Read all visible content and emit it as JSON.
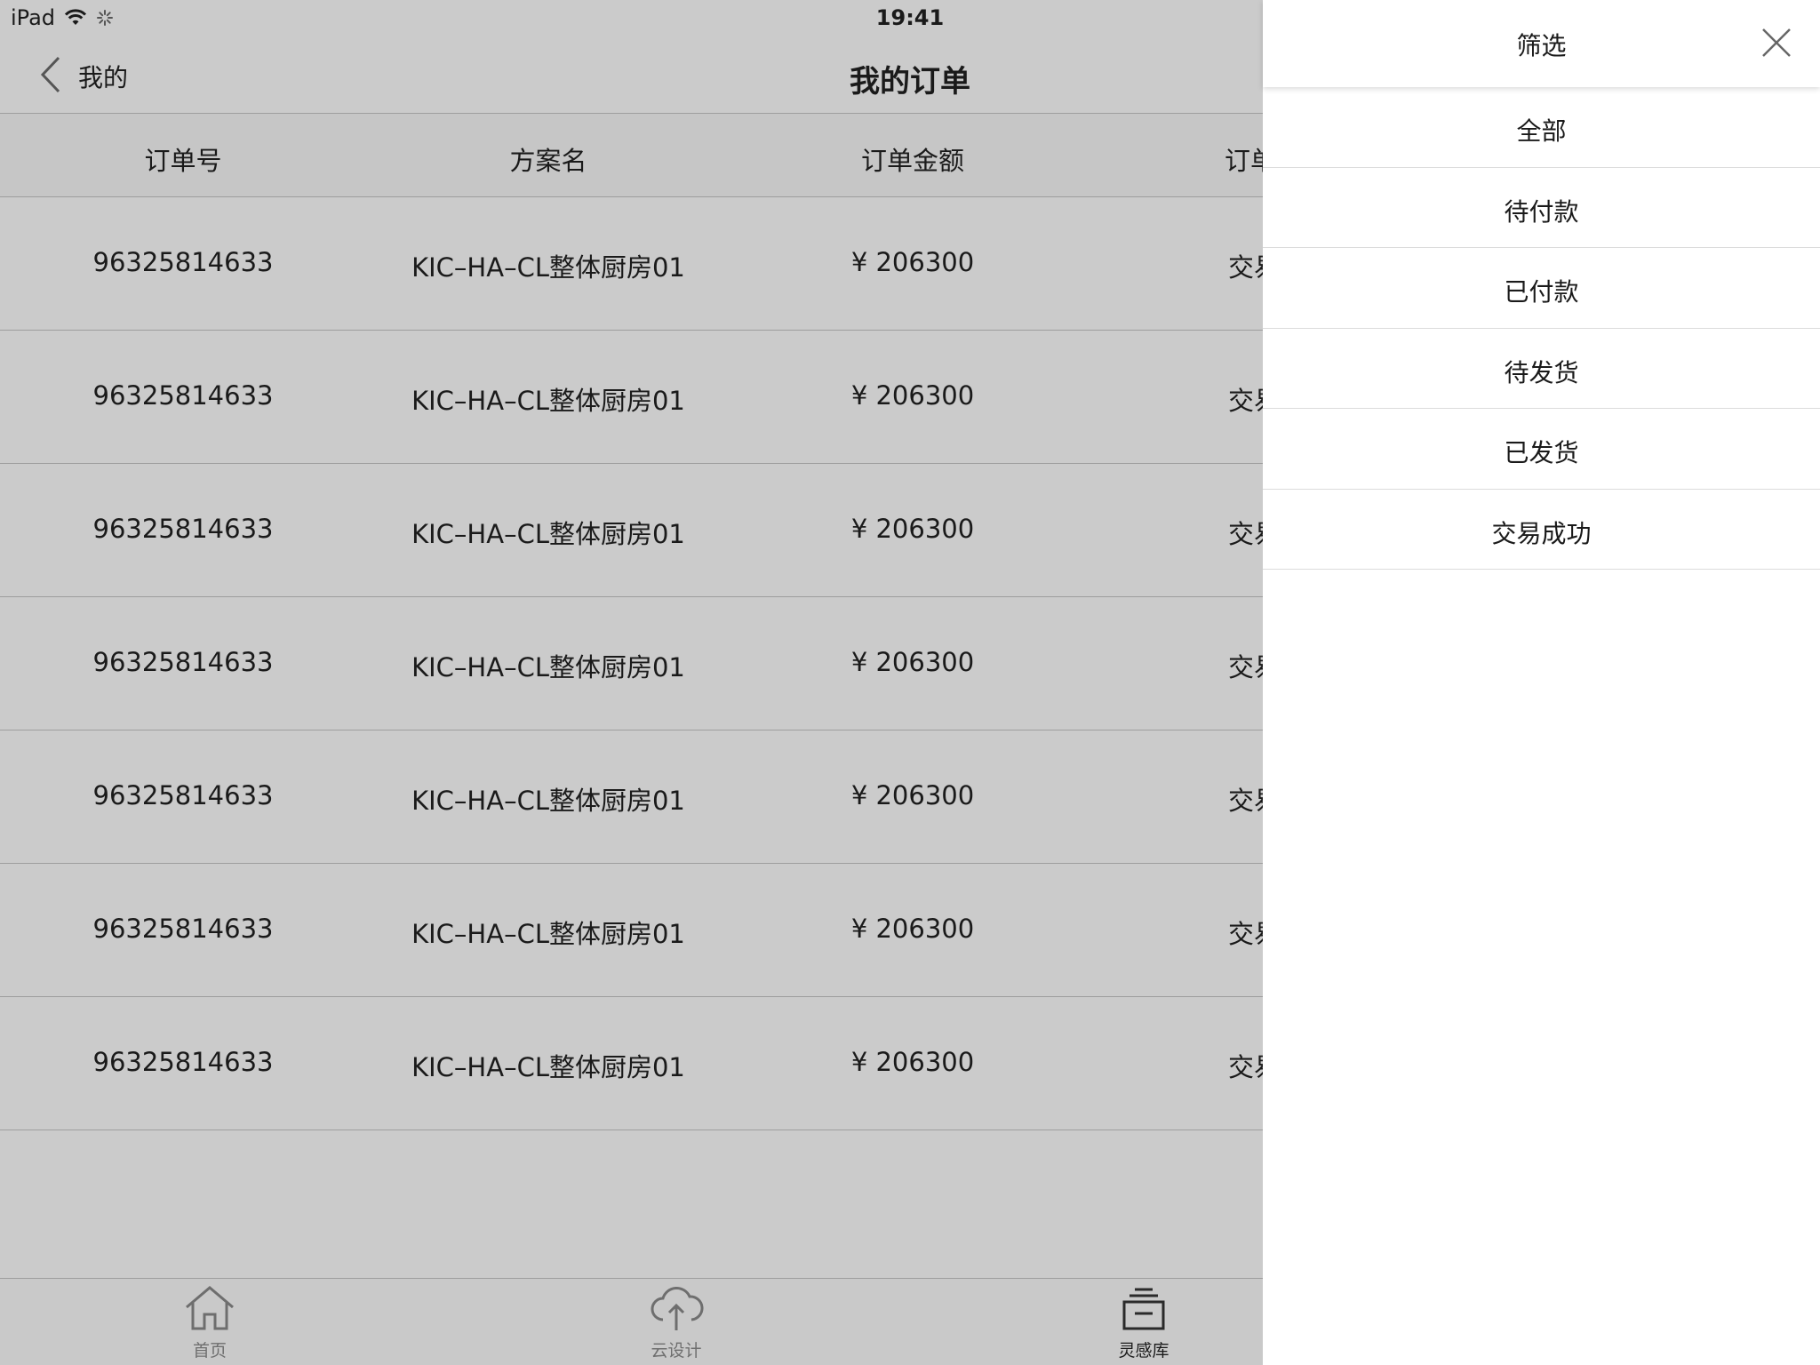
{
  "status_bar": {
    "carrier": "iPad",
    "time": "19:41"
  },
  "nav": {
    "back_label": "我的",
    "title": "我的订单"
  },
  "table": {
    "columns": [
      "订单号",
      "方案名",
      "订单金额",
      "订单"
    ],
    "rows": [
      {
        "order_no": "96325814633",
        "plan": "KIC–HA–CL整体厨房01",
        "amount": "¥ 206300",
        "status": "交易"
      },
      {
        "order_no": "96325814633",
        "plan": "KIC–HA–CL整体厨房01",
        "amount": "¥ 206300",
        "status": "交易"
      },
      {
        "order_no": "96325814633",
        "plan": "KIC–HA–CL整体厨房01",
        "amount": "¥ 206300",
        "status": "交易"
      },
      {
        "order_no": "96325814633",
        "plan": "KIC–HA–CL整体厨房01",
        "amount": "¥ 206300",
        "status": "交易"
      },
      {
        "order_no": "96325814633",
        "plan": "KIC–HA–CL整体厨房01",
        "amount": "¥ 206300",
        "status": "交易"
      },
      {
        "order_no": "96325814633",
        "plan": "KIC–HA–CL整体厨房01",
        "amount": "¥ 206300",
        "status": "交易"
      },
      {
        "order_no": "96325814633",
        "plan": "KIC–HA–CL整体厨房01",
        "amount": "¥ 206300",
        "status": "交易"
      }
    ]
  },
  "tabs": [
    {
      "label": "首页",
      "icon": "home-icon",
      "active": false
    },
    {
      "label": "云设计",
      "icon": "cloud-upload-icon",
      "active": false
    },
    {
      "label": "灵感库",
      "icon": "library-icon",
      "active": true
    }
  ],
  "filter": {
    "title": "筛选",
    "options": [
      "全部",
      "待付款",
      "已付款",
      "待发货",
      "已发货",
      "交易成功"
    ]
  },
  "colors": {
    "dim_background": "#cbcbcb",
    "drawer_background": "#ffffff",
    "divider": "#9e9e9e"
  }
}
